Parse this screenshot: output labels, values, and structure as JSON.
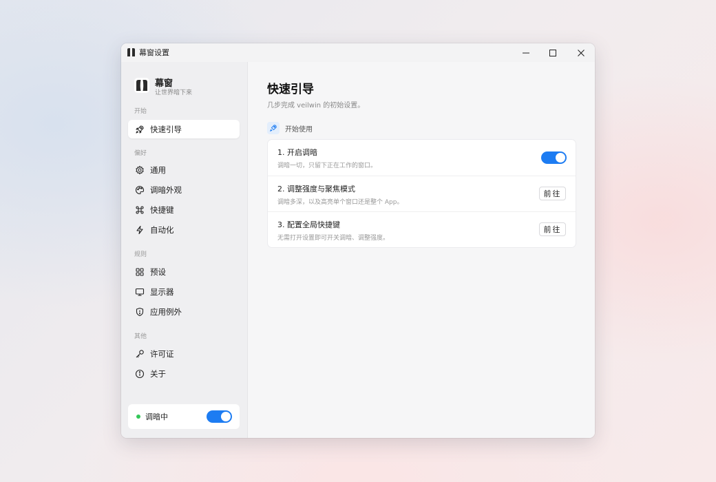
{
  "window": {
    "title": "幕窗设置",
    "controls": {
      "minimize": "minimize-icon",
      "maximize": "maximize-icon",
      "close": "close-icon"
    }
  },
  "brand": {
    "name": "幕窗",
    "tagline": "让世界暗下来"
  },
  "sidebar": {
    "sections": [
      {
        "label": "开始",
        "items": [
          {
            "label": "快速引导",
            "icon": "rocket-icon",
            "active": true
          }
        ]
      },
      {
        "label": "偏好",
        "items": [
          {
            "label": "通用",
            "icon": "gear-icon"
          },
          {
            "label": "调暗外观",
            "icon": "palette-icon"
          },
          {
            "label": "快捷键",
            "icon": "command-icon"
          },
          {
            "label": "自动化",
            "icon": "lightning-icon"
          }
        ]
      },
      {
        "label": "规则",
        "items": [
          {
            "label": "预设",
            "icon": "grid-icon"
          },
          {
            "label": "显示器",
            "icon": "monitor-icon"
          },
          {
            "label": "应用例外",
            "icon": "shield-icon"
          }
        ]
      },
      {
        "label": "其他",
        "items": [
          {
            "label": "许可证",
            "icon": "key-icon"
          },
          {
            "label": "关于",
            "icon": "info-icon"
          }
        ]
      }
    ],
    "status": {
      "label": "调暗中",
      "enabled": true
    }
  },
  "main": {
    "title": "快速引导",
    "subtitle": "几步完成 veilwin 的初始设置。",
    "group": {
      "label": "开始使用",
      "icon": "rocket-icon"
    },
    "steps": [
      {
        "title": "1. 开启调暗",
        "desc": "调暗一切，只留下正在工作的窗口。",
        "control": "toggle",
        "enabled": true
      },
      {
        "title": "2. 调整强度与聚焦模式",
        "desc": "调暗多深，以及高亮单个窗口还是整个 App。",
        "control": "button",
        "button_label": "前往"
      },
      {
        "title": "3. 配置全局快捷键",
        "desc": "无需打开设置即可开关调暗、调整强度。",
        "control": "button",
        "button_label": "前往"
      }
    ]
  },
  "colors": {
    "accent": "#1d7cf2",
    "status_dot": "#34c759"
  }
}
